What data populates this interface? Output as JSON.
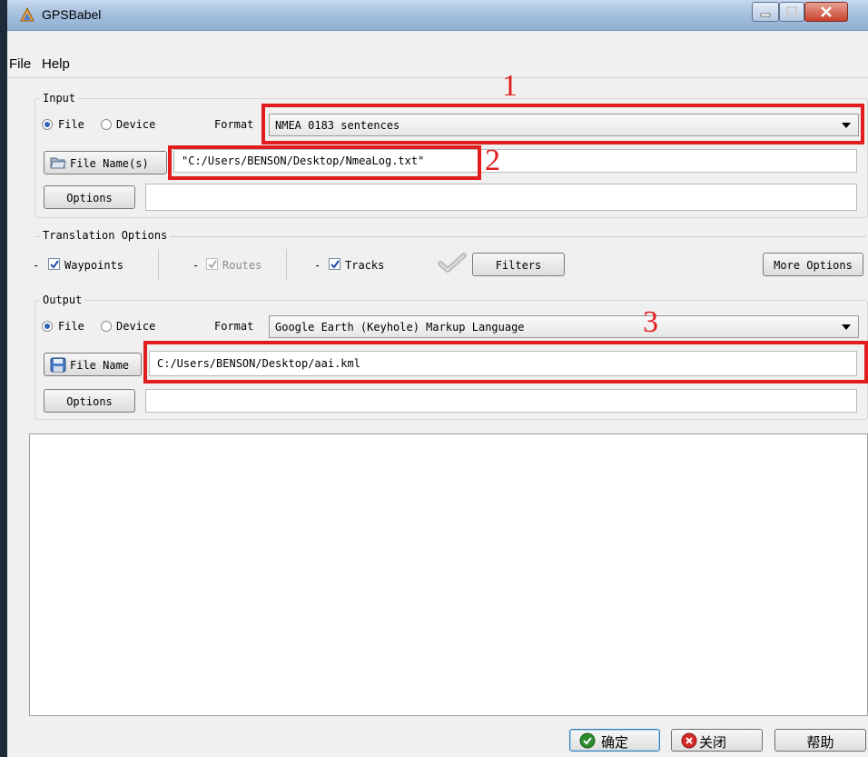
{
  "window": {
    "title": "GPSBabel"
  },
  "menu": {
    "file": "File",
    "help": "Help"
  },
  "input": {
    "legend": "Input",
    "file_label": "File",
    "device_label": "Device",
    "format_label": "Format",
    "format_value": "NMEA 0183 sentences",
    "filename_button": "File Name(s)",
    "filename_value": "\"C:/Users/BENSON/Desktop/NmeaLog.txt\"",
    "options_button": "Options",
    "options_value": ""
  },
  "translation": {
    "legend": "Translation Options",
    "waypoints": "Waypoints",
    "routes": "Routes",
    "tracks": "Tracks",
    "dash": "-",
    "filters": "Filters",
    "more_options": "More Options"
  },
  "output": {
    "legend": "Output",
    "file_label": "File",
    "device_label": "Device",
    "format_label": "Format",
    "format_value": "Google Earth (Keyhole) Markup Language",
    "filename_button": "File Name",
    "filename_value": "C:/Users/BENSON/Desktop/aai.kml",
    "options_button": "Options",
    "options_value": ""
  },
  "annotations": {
    "n1": "1",
    "n2": "2",
    "n3": "3"
  },
  "buttons": {
    "ok": "确定",
    "close": "关闭",
    "help": "帮助"
  },
  "colors": {
    "annotation_red": "#e21d1d",
    "title_bar": "#a9c2df"
  }
}
